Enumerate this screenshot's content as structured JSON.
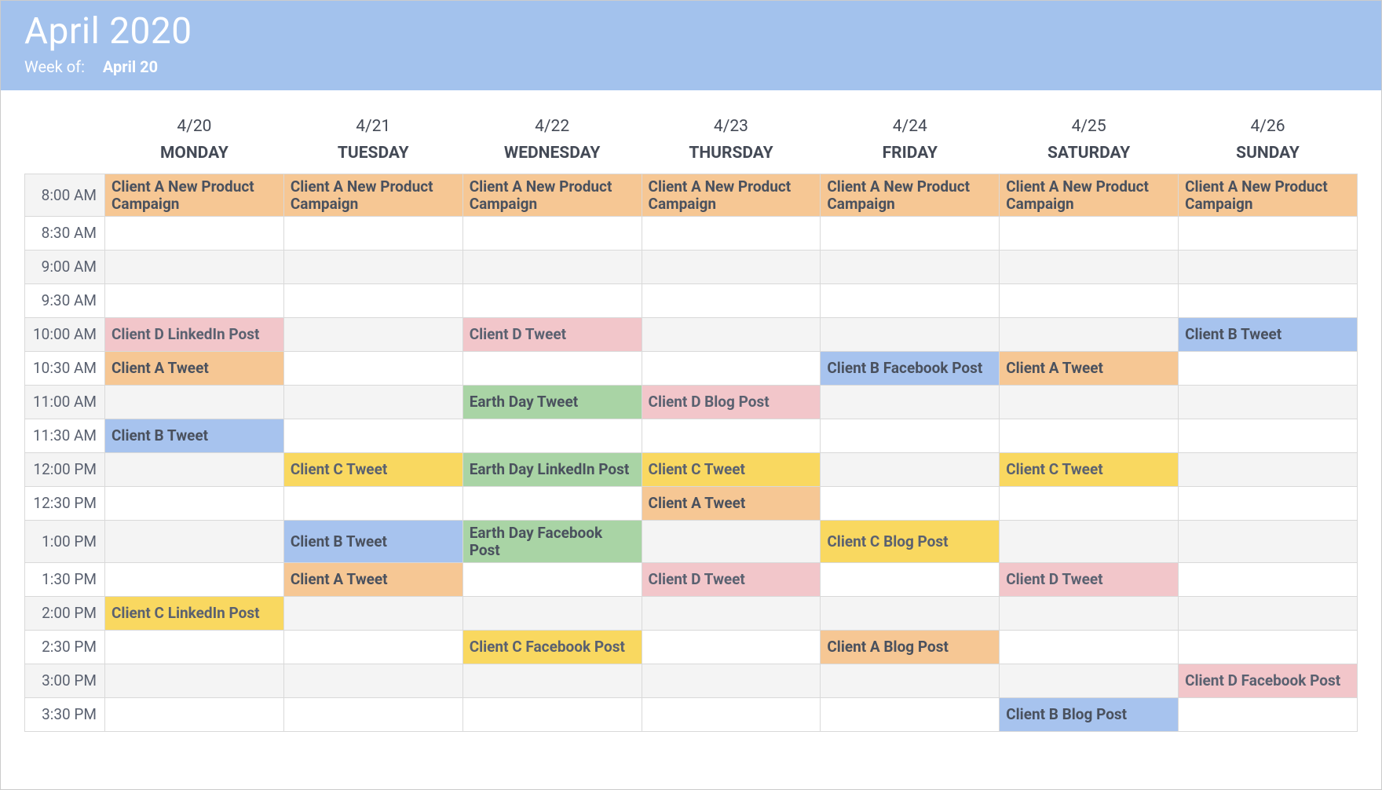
{
  "header": {
    "title": "April 2020",
    "week_label": "Week of:",
    "week_value": "April 20"
  },
  "days": [
    {
      "date": "4/20",
      "name": "MONDAY"
    },
    {
      "date": "4/21",
      "name": "TUESDAY"
    },
    {
      "date": "4/22",
      "name": "WEDNESDAY"
    },
    {
      "date": "4/23",
      "name": "THURSDAY"
    },
    {
      "date": "4/24",
      "name": "FRIDAY"
    },
    {
      "date": "4/25",
      "name": "SATURDAY"
    },
    {
      "date": "4/26",
      "name": "SUNDAY"
    }
  ],
  "times": [
    "8:00 AM",
    "8:30 AM",
    "9:00 AM",
    "9:30 AM",
    "10:00 AM",
    "10:30 AM",
    "11:00 AM",
    "11:30 AM",
    "12:00 PM",
    "12:30 PM",
    "1:00 PM",
    "1:30 PM",
    "2:00 PM",
    "2:30 PM",
    "3:00 PM",
    "3:30 PM"
  ],
  "colors": {
    "orange": "#f6c794",
    "pink": "#f2c6ca",
    "yellow": "#f9d860",
    "blue": "#a7c3ee",
    "green": "#a9d4a5"
  },
  "events": {
    "8:00 AM": {
      "4/20": {
        "text": "Client A New Product Campaign",
        "color": "orange"
      },
      "4/21": {
        "text": "Client A New Product Campaign",
        "color": "orange"
      },
      "4/22": {
        "text": "Client A New Product Campaign",
        "color": "orange"
      },
      "4/23": {
        "text": "Client A New Product Campaign",
        "color": "orange"
      },
      "4/24": {
        "text": "Client A New Product Campaign",
        "color": "orange"
      },
      "4/25": {
        "text": "Client A New Product Campaign",
        "color": "orange"
      },
      "4/26": {
        "text": "Client A New Product Campaign",
        "color": "orange"
      }
    },
    "10:00 AM": {
      "4/20": {
        "text": "Client D LinkedIn Post",
        "color": "pink"
      },
      "4/22": {
        "text": "Client D Tweet",
        "color": "pink"
      },
      "4/26": {
        "text": "Client B Tweet",
        "color": "blue"
      }
    },
    "10:30 AM": {
      "4/20": {
        "text": "Client A Tweet",
        "color": "orange"
      },
      "4/24": {
        "text": "Client B Facebook Post",
        "color": "blue"
      },
      "4/25": {
        "text": "Client A Tweet",
        "color": "orange"
      }
    },
    "11:00 AM": {
      "4/22": {
        "text": "Earth Day Tweet",
        "color": "green"
      },
      "4/23": {
        "text": "Client D Blog Post",
        "color": "pink"
      }
    },
    "11:30 AM": {
      "4/20": {
        "text": "Client B Tweet",
        "color": "blue"
      }
    },
    "12:00 PM": {
      "4/21": {
        "text": "Client C Tweet",
        "color": "yellow"
      },
      "4/22": {
        "text": "Earth Day LinkedIn Post",
        "color": "green"
      },
      "4/23": {
        "text": "Client C Tweet",
        "color": "yellow"
      },
      "4/25": {
        "text": "Client C Tweet",
        "color": "yellow"
      }
    },
    "12:30 PM": {
      "4/23": {
        "text": "Client A Tweet",
        "color": "orange"
      }
    },
    "1:00 PM": {
      "4/21": {
        "text": "Client B Tweet",
        "color": "blue"
      },
      "4/22": {
        "text": "Earth Day Facebook Post",
        "color": "green"
      },
      "4/24": {
        "text": "Client C Blog Post",
        "color": "yellow"
      }
    },
    "1:30 PM": {
      "4/21": {
        "text": "Client A Tweet",
        "color": "orange"
      },
      "4/23": {
        "text": "Client D Tweet",
        "color": "pink"
      },
      "4/25": {
        "text": "Client D Tweet",
        "color": "pink"
      }
    },
    "2:00 PM": {
      "4/20": {
        "text": "Client C LinkedIn Post",
        "color": "yellow"
      }
    },
    "2:30 PM": {
      "4/22": {
        "text": "Client C Facebook Post",
        "color": "yellow"
      },
      "4/24": {
        "text": "Client A Blog Post",
        "color": "orange"
      }
    },
    "3:00 PM": {
      "4/26": {
        "text": "Client D Facebook Post",
        "color": "pink"
      }
    },
    "3:30 PM": {
      "4/25": {
        "text": "Client B Blog Post",
        "color": "blue"
      }
    }
  }
}
